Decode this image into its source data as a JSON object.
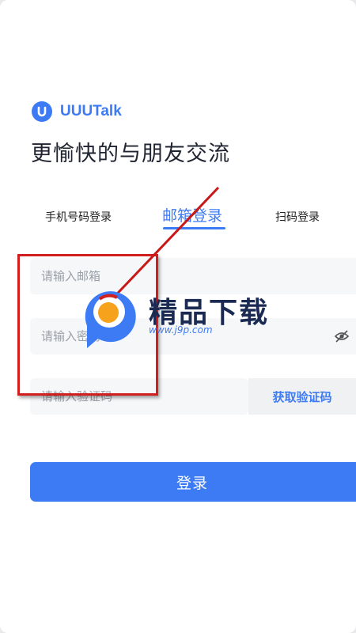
{
  "brand": {
    "name": "UUUTalk",
    "icon": "uuu-logo-icon",
    "color": "#3d7bf5"
  },
  "slogan": "更愉快的与朋友交流",
  "tabs": [
    {
      "label": "手机号码登录",
      "active": false
    },
    {
      "label": "邮箱登录",
      "active": true
    },
    {
      "label": "扫码登录",
      "active": false
    }
  ],
  "form": {
    "email_placeholder": "请输入邮箱",
    "password_placeholder": "请输入密码",
    "code_placeholder": "请输入验证码",
    "get_code_label": "获取验证码",
    "password_toggle_icon": "eye-off-icon",
    "submit_label": "登录"
  },
  "watermark": {
    "title": "精品下载",
    "url": "www.j9p.com",
    "highlight_color": "#d21e1e"
  }
}
